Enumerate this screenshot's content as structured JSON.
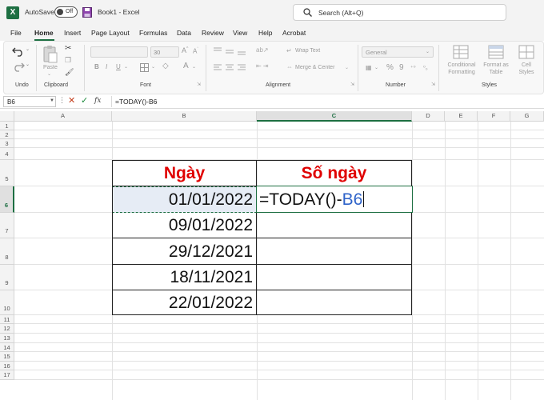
{
  "titlebar": {
    "app_logo": "X",
    "autosave_label": "AutoSave",
    "autosave_state": "Off",
    "book_title": "Book1  -  Excel",
    "search_placeholder": "Search (Alt+Q)",
    "icons": {
      "search": "search-icon",
      "save": "save-icon",
      "logo": "excel-logo-icon"
    }
  },
  "menu": {
    "tabs": [
      "File",
      "Home",
      "Insert",
      "Page Layout",
      "Formulas",
      "Data",
      "Review",
      "View",
      "Help",
      "Acrobat"
    ],
    "active": "Home"
  },
  "ribbon": {
    "groups": [
      "Undo",
      "Clipboard",
      "Font",
      "Alignment",
      "Number",
      "Styles"
    ],
    "paste_label": "Paste",
    "font_size": "30",
    "font_buttons": [
      "B",
      "I",
      "U"
    ],
    "wrap_text": "Wrap Text",
    "merge_center": "Merge & Center",
    "number_format": "General",
    "number_symbols": [
      "%",
      "9"
    ],
    "styles": [
      "Conditional Formatting",
      "Format as Table",
      "Cell Styles"
    ],
    "accent": "#1d6f42"
  },
  "formula_bar": {
    "name_box": "B6",
    "formula": "=TODAY()-B6",
    "fx_label": "fx"
  },
  "sheet": {
    "columns": [
      "A",
      "B",
      "C",
      "D",
      "E",
      "F",
      "G"
    ],
    "selected_column": "C",
    "rows": [
      "1",
      "2",
      "3",
      "4",
      "5",
      "6",
      "7",
      "8",
      "9",
      "10",
      "11",
      "12",
      "13",
      "14",
      "15",
      "16",
      "17"
    ],
    "selected_row": "6",
    "table": {
      "header_b": "Ngày",
      "header_c": "Số ngày",
      "dates": [
        "01/01/2022",
        "09/01/2022",
        "29/12/2021",
        "18/11/2021",
        "22/01/2022"
      ],
      "formula_main": "=TODAY()-",
      "formula_ref": "B6"
    },
    "colors": {
      "header_text": "#e00000",
      "ref_text": "#2e63c9",
      "selection": "#1d6f42"
    }
  }
}
